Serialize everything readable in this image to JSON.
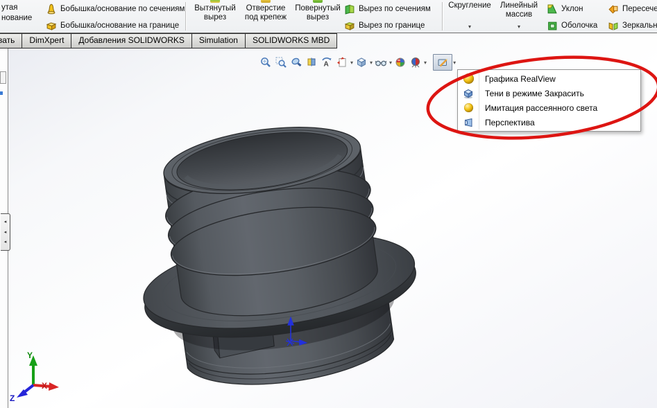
{
  "ribbon": {
    "partial_left": {
      "line1": "утая",
      "line2": "нование"
    },
    "group1": {
      "items": [
        {
          "label": "Бобышка/основание по сечениям",
          "icon": "loft-boss-icon"
        },
        {
          "label": "Бобышка/основание на границе",
          "icon": "boundary-boss-icon"
        }
      ]
    },
    "group2": {
      "big_buttons": [
        {
          "label": "Вытянутый вырез",
          "icon": "extruded-cut-icon"
        },
        {
          "label": "Отверстие под крепеж",
          "icon": "hole-wizard-icon"
        },
        {
          "label": "Повернутый вырез",
          "icon": "revolved-cut-icon"
        }
      ],
      "items": [
        {
          "label": "Вырез по сечениям",
          "icon": "lofted-cut-icon"
        },
        {
          "label": "Вырез по границе",
          "icon": "boundary-cut-icon"
        }
      ]
    },
    "group3": {
      "big_buttons": [
        {
          "label": "Скругление",
          "icon": "fillet-icon"
        },
        {
          "label": "Линейный массив",
          "icon": "linear-pattern-icon"
        }
      ],
      "items": [
        {
          "label": "Уклон",
          "icon": "draft-icon"
        },
        {
          "label": "Оболочка",
          "icon": "shell-icon"
        }
      ],
      "partial_items": [
        {
          "label": "Пересече",
          "icon": "intersect-icon"
        },
        {
          "label": "Зеркальн",
          "icon": "mirror-icon"
        }
      ]
    }
  },
  "tabs": [
    {
      "label": "вать"
    },
    {
      "label": "DimXpert"
    },
    {
      "label": "Добавления SOLIDWORKS"
    },
    {
      "label": "Simulation"
    },
    {
      "label": "SOLIDWORKS MBD"
    }
  ],
  "view_toolbar": {
    "icons": [
      "zoom-to-fit",
      "zoom-to-area",
      "magnify",
      "section-view",
      "rotate-view",
      "view-orientation",
      "display-style",
      "hide-show-items",
      "edit-appearance",
      "apply-scene",
      "view-settings"
    ]
  },
  "view_settings_menu": {
    "items": [
      {
        "label": "Графика RealView",
        "icon": "realview-sphere-icon"
      },
      {
        "label": "Тени в режиме Закрасить",
        "icon": "shaded-shadows-cube-icon"
      },
      {
        "label": "Имитация рассеянного света",
        "icon": "ambient-light-sphere-icon"
      },
      {
        "label": "Перспектива",
        "icon": "perspective-box-icon"
      }
    ]
  },
  "triad": {
    "x_label": "X",
    "y_label": "Y",
    "z_label": "Z"
  },
  "colors": {
    "annotation_red": "#dd1512",
    "model_gray": "#4e5257",
    "viewport_top": "#e9ebf1",
    "menu_border": "#979797"
  }
}
